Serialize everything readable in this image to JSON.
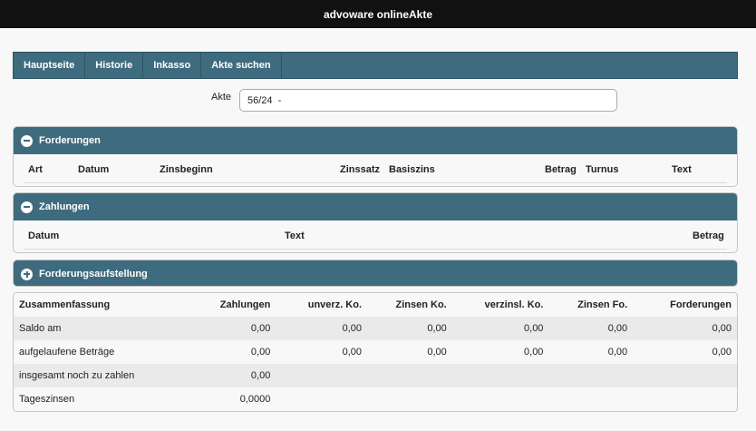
{
  "window": {
    "title": "advoware onlineAkte"
  },
  "nav": {
    "tabs": [
      "Hauptseite",
      "Historie",
      "Inkasso",
      "Akte suchen"
    ]
  },
  "akte": {
    "label": "Akte",
    "value": "56/24  -"
  },
  "forderungen": {
    "title": "Forderungen",
    "columns": [
      "Art",
      "Datum",
      "Zinsbeginn",
      "Zinssatz",
      "Basiszins",
      "Betrag",
      "Turnus",
      "Text"
    ]
  },
  "zahlungen": {
    "title": "Zahlungen",
    "columns": [
      "Datum",
      "Text",
      "Betrag"
    ]
  },
  "aufstellung": {
    "title": "Forderungsaufstellung"
  },
  "summary": {
    "headers": [
      "Zusammenfassung",
      "Zahlungen",
      "unverz. Ko.",
      "Zinsen Ko.",
      "verzinsl. Ko.",
      "Zinsen Fo.",
      "Forderungen"
    ],
    "rows": [
      {
        "label": "Saldo am",
        "values": [
          "0,00",
          "0,00",
          "0,00",
          "0,00",
          "0,00",
          "0,00"
        ]
      },
      {
        "label": "aufgelaufene Beträge",
        "values": [
          "0,00",
          "0,00",
          "0,00",
          "0,00",
          "0,00",
          "0,00"
        ]
      },
      {
        "label": "insgesamt noch zu zahlen",
        "values": [
          "0,00",
          "",
          "",
          "",
          "",
          ""
        ]
      },
      {
        "label": "Tageszinsen",
        "values": [
          "0,0000",
          "",
          "",
          "",
          "",
          ""
        ]
      }
    ]
  }
}
